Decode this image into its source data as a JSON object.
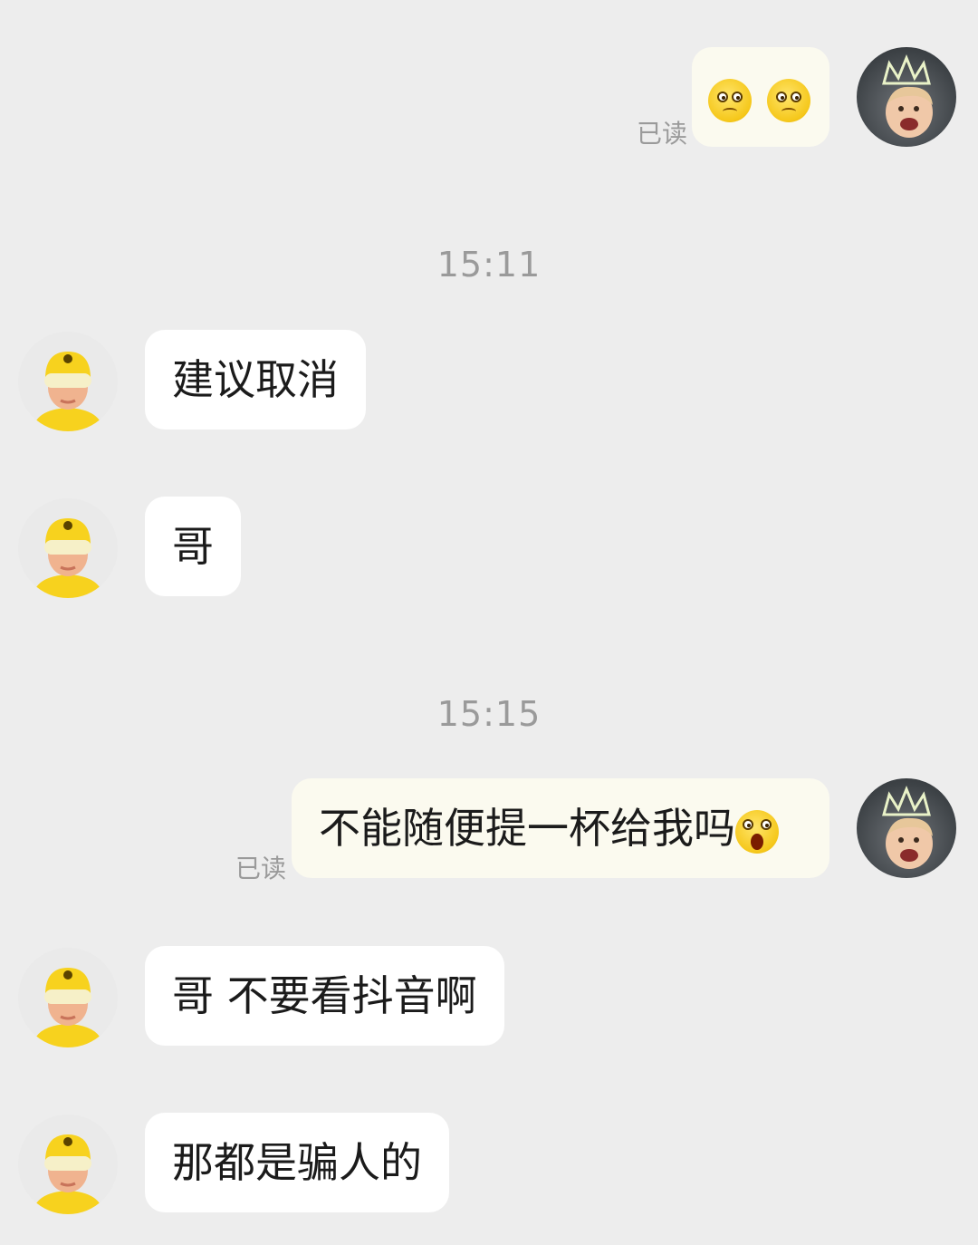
{
  "chat": {
    "read_label": "已读",
    "timestamps": [
      "15:11",
      "15:15"
    ],
    "messages": {
      "m1": {
        "sender": "me",
        "emojis": [
          "worried-face",
          "worried-face"
        ]
      },
      "m2": {
        "sender": "rider",
        "text": "建议取消"
      },
      "m3": {
        "sender": "rider",
        "text": "哥"
      },
      "m4": {
        "sender": "me",
        "text": "不能随便提一杯给我吗",
        "emoji": "screaming-face"
      },
      "m5": {
        "sender": "rider",
        "text": "哥 不要看抖音啊"
      },
      "m6": {
        "sender": "rider",
        "text": "那都是骗人的"
      }
    }
  },
  "colors": {
    "background": "#ededed",
    "bubble_rider": "#ffffff",
    "bubble_me": "#fbfaef",
    "rider_avatar_yellow": "#f7d21e",
    "timestamp_text": "#9a9a9a"
  }
}
